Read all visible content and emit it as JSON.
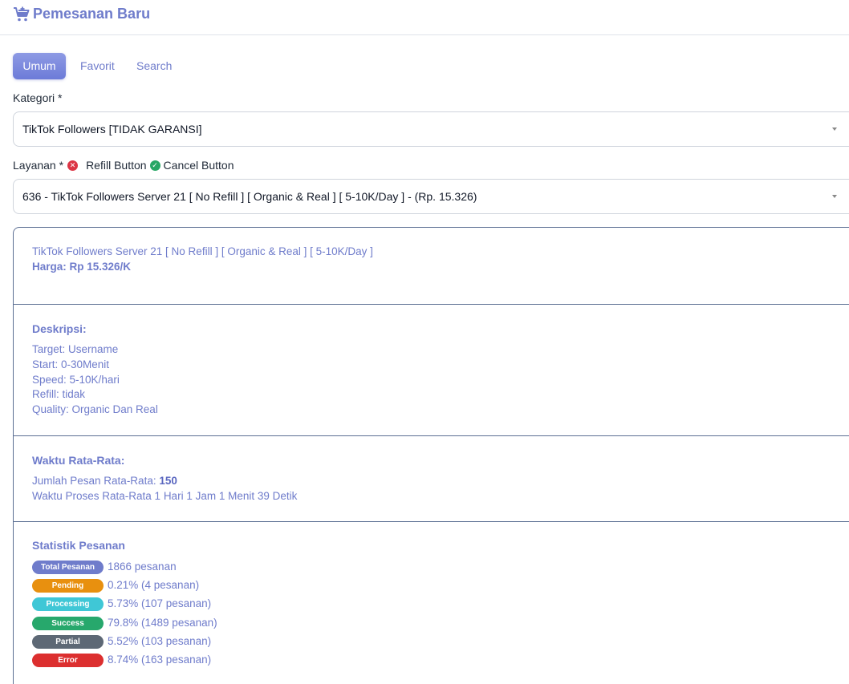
{
  "header": {
    "title": "Pemesanan Baru",
    "icon": "cart-plus-icon"
  },
  "tabs": [
    {
      "label": "Umum",
      "active": true
    },
    {
      "label": "Favorit",
      "active": false
    },
    {
      "label": "Search",
      "active": false
    }
  ],
  "kategori": {
    "label": "Kategori *",
    "selected": "TikTok Followers [TIDAK GARANSI]"
  },
  "layanan": {
    "label": "Layanan *",
    "refill_label": "Refill Button",
    "cancel_label": "Cancel Button",
    "selected": "636 - TikTok Followers Server 21 [ No Refill ] [ Organic & Real ] [ 5-10K/Day ] - (Rp. 15.326)"
  },
  "service_info": {
    "name": "TikTok Followers Server 21 [ No Refill ] [ Organic & Real ] [ 5-10K/Day ]",
    "price": "Harga: Rp 15.326/K"
  },
  "deskripsi": {
    "heading": "Deskripsi:",
    "lines": [
      "Target: Username",
      "Start: 0-30Menit",
      "Speed: 5-10K/hari",
      "Refill: tidak",
      "Quality: Organic Dan Real"
    ]
  },
  "waktu": {
    "heading": "Waktu Rata-Rata:",
    "jumlah_label": "Jumlah Pesan Rata-Rata: ",
    "jumlah_value": "150",
    "proses": "Waktu Proses Rata-Rata 1 Hari 1 Jam 1 Menit 39 Detik"
  },
  "statistik": {
    "heading": "Statistik Pesanan",
    "rows": [
      {
        "badge": "Total Pesanan",
        "value": "1866 pesanan",
        "color": "#6f7ccb"
      },
      {
        "badge": "Pending",
        "value": "0.21% (4 pesanan)",
        "color": "#e8900f"
      },
      {
        "badge": "Processing",
        "value": "5.73% (107 pesanan)",
        "color": "#3fc7d6"
      },
      {
        "badge": "Success",
        "value": "79.8% (1489 pesanan)",
        "color": "#27a86c"
      },
      {
        "badge": "Partial",
        "value": "5.52% (103 pesanan)",
        "color": "#5d6875"
      },
      {
        "badge": "Error",
        "value": "8.74% (163 pesanan)",
        "color": "#dc2f2f"
      }
    ]
  }
}
